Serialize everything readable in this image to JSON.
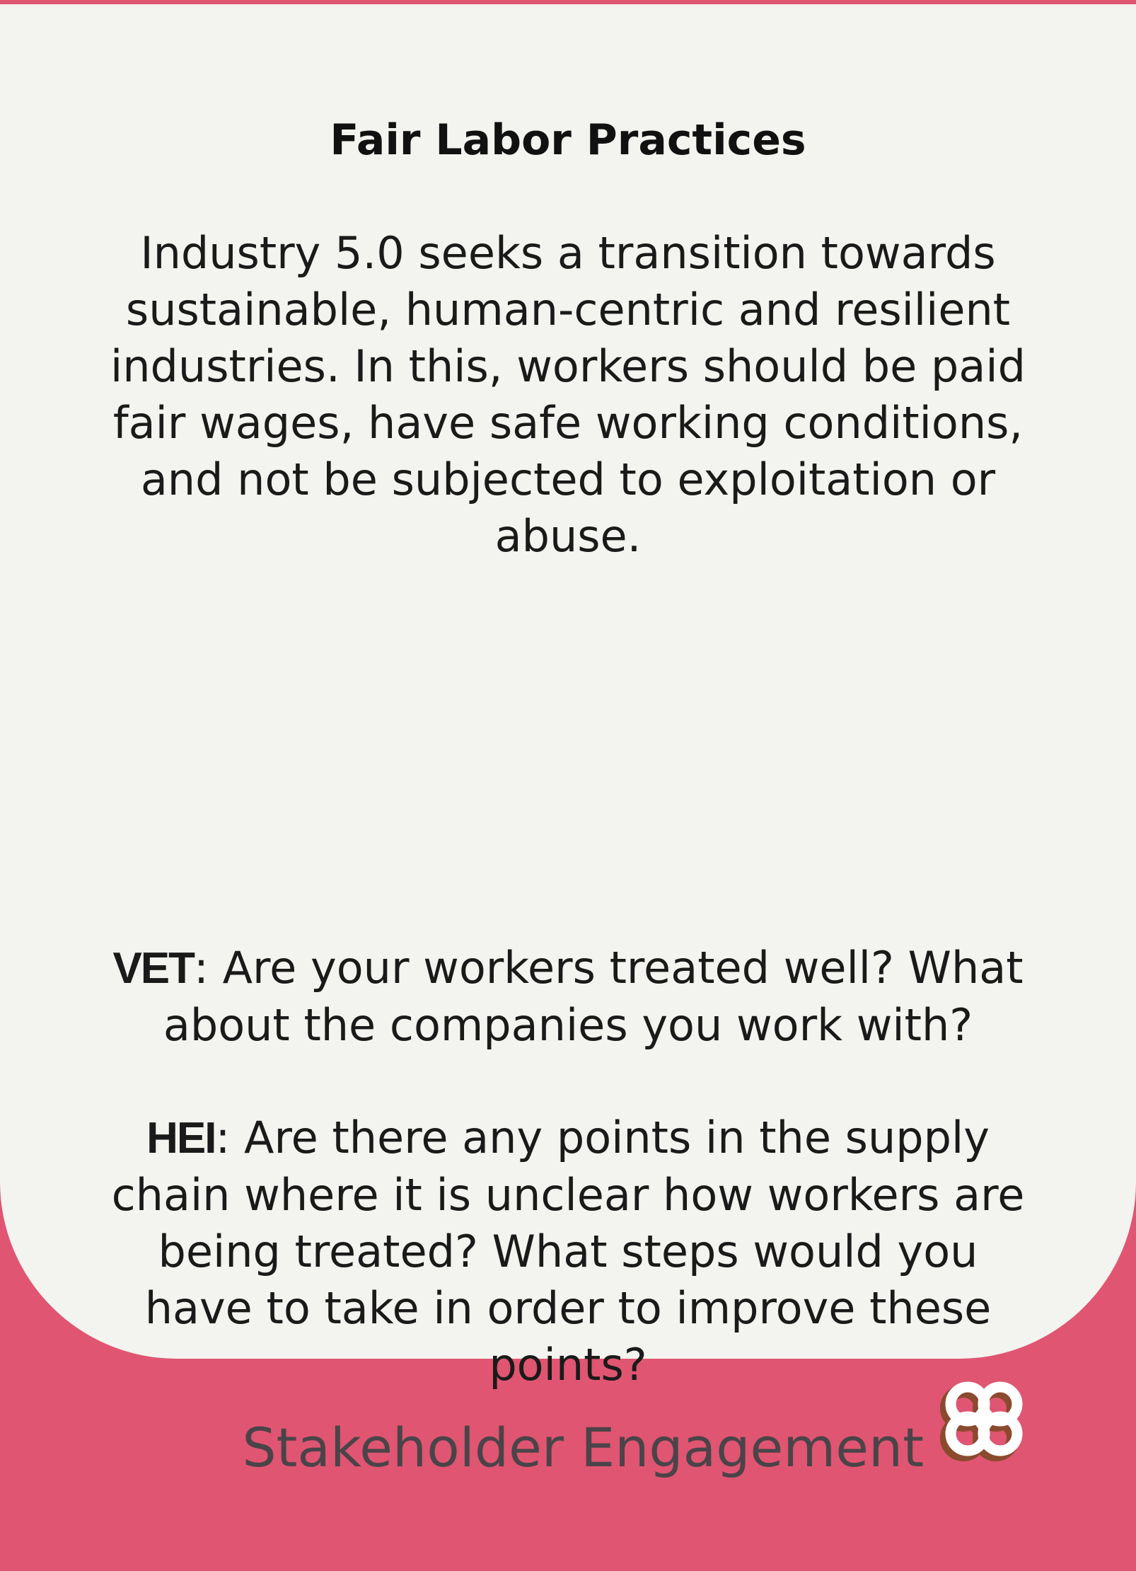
{
  "card": {
    "title": "Fair Labor Practices",
    "intro": "Industry 5.0 seeks a transition towards sustainable, human-centric and resilient industries. In this, workers should be paid fair wages, have safe working conditions, and not be subjected to exploitation or abuse.",
    "prompts": [
      {
        "tag": "VET",
        "text": ": Are your workers treated well? What about the companies you work with?"
      },
      {
        "tag": "HEI",
        "text": ": Are there any points in the supply chain where it is unclear how workers are being treated? What steps would you have to take in order to improve these points?"
      }
    ]
  },
  "footer": {
    "category": "Stakeholder Engagement",
    "icon": "linked-rings-icon"
  },
  "colors": {
    "accent": "#e05571",
    "panel": "#f3f3ef",
    "category_text": "#4a4449",
    "icon_shadow": "#8a4a2e",
    "icon_fill": "#ffffff"
  }
}
